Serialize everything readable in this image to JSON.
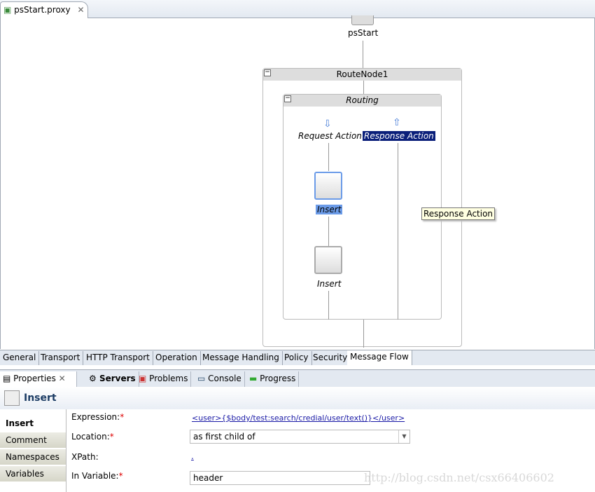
{
  "editor": {
    "tab_label": "psStart.proxy"
  },
  "flow": {
    "start": "psStart",
    "route_node": "RouteNode1",
    "routing": "Routing",
    "request_action": "Request Action",
    "response_action": "Response Action",
    "insert1": "Insert",
    "insert2": "Insert",
    "tooltip": "Response Action"
  },
  "bottom_tabs": [
    "General",
    "Transport",
    "HTTP Transport",
    "Operation",
    "Message Handling",
    "Policy",
    "Security",
    "Message Flow"
  ],
  "view_tabs": [
    "Properties",
    "Servers",
    "Problems",
    "Console",
    "Progress"
  ],
  "properties": {
    "title": "Insert",
    "side_tabs": [
      "Insert",
      "Comment",
      "Namespaces",
      "Variables"
    ],
    "expression_label": "Expression:",
    "expression_value": "<user>{$body/test:search/credial/user/text()}</user>",
    "location_label": "Location:",
    "location_value": "as first child of",
    "xpath_label": "XPath:",
    "xpath_value": ".",
    "variable_label": "In Variable:",
    "variable_value": "header"
  },
  "watermark": "http://blog.csdn.net/csx66406602"
}
